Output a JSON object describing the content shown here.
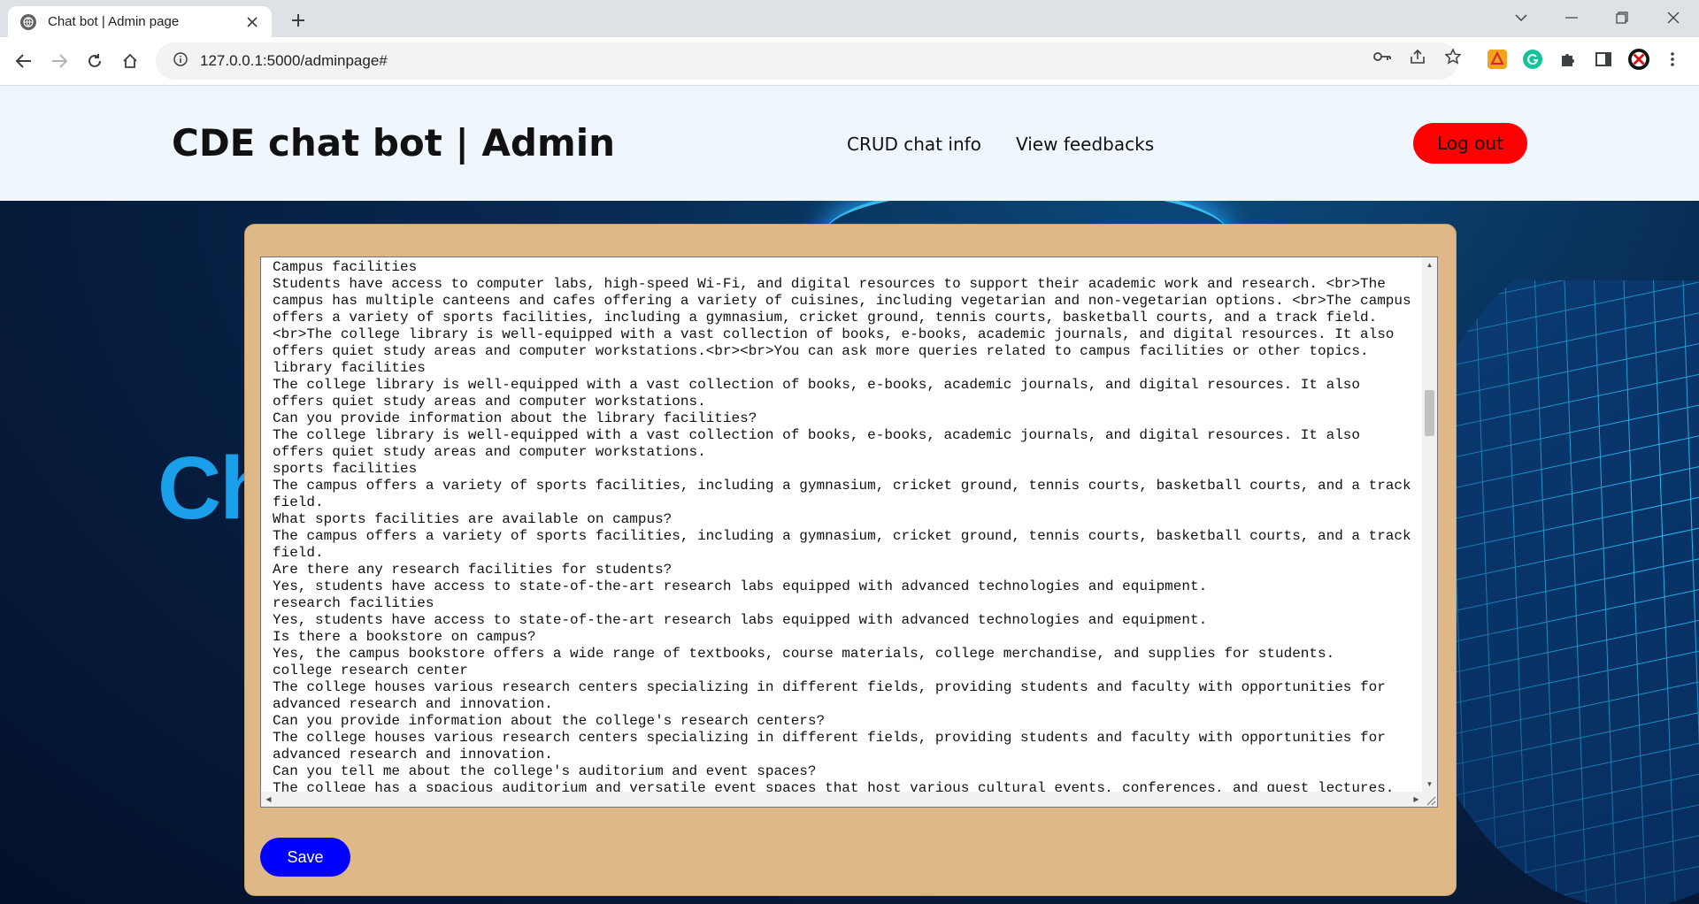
{
  "browser": {
    "tab_title": "Chat bot | Admin page",
    "url": "127.0.0.1:5000/adminpage#"
  },
  "header": {
    "brand": "CDE chat bot | Admin",
    "nav": [
      {
        "label": "CRUD chat info"
      },
      {
        "label": "View feedbacks"
      }
    ],
    "logout_label": "Log out"
  },
  "background": {
    "hero_word": "Ch"
  },
  "editor": {
    "content": "Campus facilities\nStudents have access to computer labs, high-speed Wi-Fi, and digital resources to support their academic work and research. <br>The campus has multiple canteens and cafes offering a variety of cuisines, including vegetarian and non-vegetarian options. <br>The campus offers a variety of sports facilities, including a gymnasium, cricket ground, tennis courts, basketball courts, and a track field. <br>The college library is well-equipped with a vast collection of books, e-books, academic journals, and digital resources. It also offers quiet study areas and computer workstations.<br><br>You can ask more queries related to campus facilities or other topics.\nlibrary facilities\nThe college library is well-equipped with a vast collection of books, e-books, academic journals, and digital resources. It also offers quiet study areas and computer workstations.\nCan you provide information about the library facilities?\nThe college library is well-equipped with a vast collection of books, e-books, academic journals, and digital resources. It also offers quiet study areas and computer workstations.\nsports facilities\nThe campus offers a variety of sports facilities, including a gymnasium, cricket ground, tennis courts, basketball courts, and a track field.\nWhat sports facilities are available on campus?\nThe campus offers a variety of sports facilities, including a gymnasium, cricket ground, tennis courts, basketball courts, and a track field.\nAre there any research facilities for students?\nYes, students have access to state-of-the-art research labs equipped with advanced technologies and equipment.\nresearch facilities\nYes, students have access to state-of-the-art research labs equipped with advanced technologies and equipment.\nIs there a bookstore on campus?\nYes, the campus bookstore offers a wide range of textbooks, course materials, college merchandise, and supplies for students.\ncollege research center\nThe college houses various research centers specializing in different fields, providing students and faculty with opportunities for advanced research and innovation.\nCan you provide information about the college's research centers?\nThe college houses various research centers specializing in different fields, providing students and faculty with opportunities for advanced research and innovation.\nCan you tell me about the college's auditorium and event spaces?\nThe college has a spacious auditorium and versatile event spaces that host various cultural events, conferences, and guest lectures."
  },
  "save_label": "Save",
  "icons": {
    "favicon": "globe-icon",
    "security": "info-circle-icon",
    "password": "key-icon",
    "share": "share-icon",
    "bookmark": "star-icon",
    "extensions": "puzzle-icon",
    "sidepanel": "side-panel-icon",
    "menu": "kebab-menu-icon"
  }
}
